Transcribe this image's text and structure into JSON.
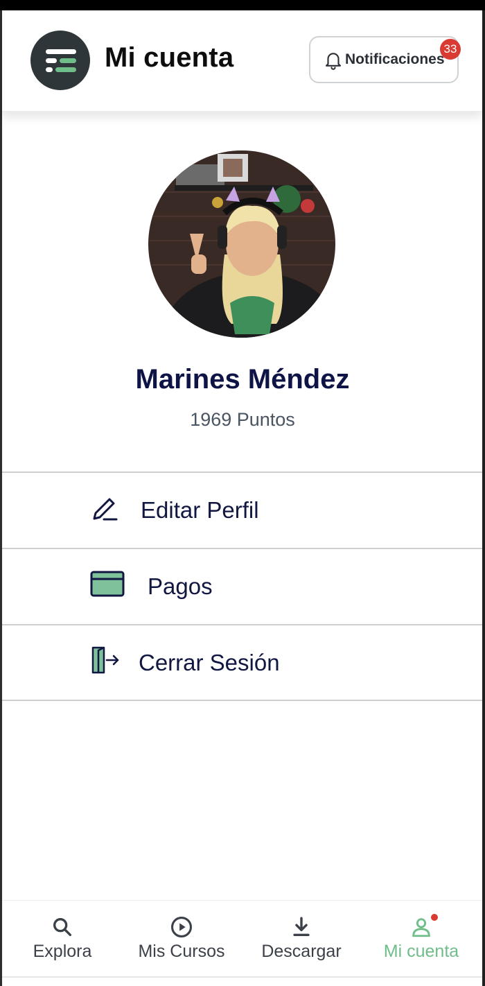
{
  "header": {
    "title": "Mi cuenta",
    "notifications_label": "Notificaciones",
    "notifications_count": "33"
  },
  "profile": {
    "name": "Marines Méndez",
    "points": "1969 Puntos"
  },
  "menu": {
    "items": [
      {
        "label": "Editar Perfil",
        "icon": "pencil-icon"
      },
      {
        "label": "Pagos",
        "icon": "credit-card-icon"
      },
      {
        "label": "Cerrar Sesión",
        "icon": "logout-icon"
      }
    ]
  },
  "bottom_nav": {
    "items": [
      {
        "label": "Explora",
        "icon": "search-icon",
        "active": false
      },
      {
        "label": "Mis Cursos",
        "icon": "play-circle-icon",
        "active": false
      },
      {
        "label": "Descargar",
        "icon": "download-icon",
        "active": false
      },
      {
        "label": "Mi cuenta",
        "icon": "user-icon",
        "active": true
      }
    ]
  },
  "colors": {
    "accent_green": "#6fbe8a",
    "navy_text": "#0e1446",
    "badge_red": "#d93a32",
    "logo_dark": "#2f3639"
  }
}
